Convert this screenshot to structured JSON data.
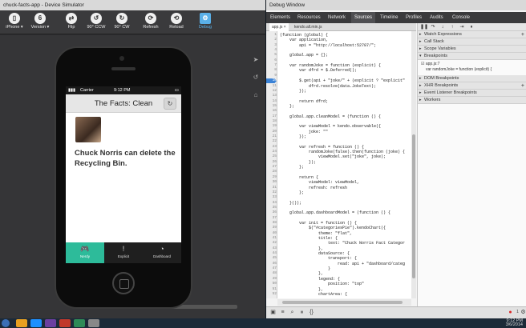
{
  "simulator": {
    "title": "chuck-facts-app - Device Simulator",
    "toolbar": [
      {
        "label": "iPhone ▾",
        "icon": "phone-icon",
        "glyph": "▯"
      },
      {
        "label": "Version ▾",
        "icon": "version-icon",
        "glyph": "6"
      },
      {
        "label": "Flip",
        "icon": "flip-icon",
        "glyph": "⇄"
      },
      {
        "label": "90° CCW",
        "icon": "rotate-ccw-icon",
        "glyph": "↺"
      },
      {
        "label": "90° CW",
        "icon": "rotate-cw-icon",
        "glyph": "↻"
      },
      {
        "label": "Refresh",
        "icon": "refresh-icon",
        "glyph": "⟳"
      },
      {
        "label": "Reload",
        "icon": "reload-icon",
        "glyph": "⟲"
      },
      {
        "label": "Debug",
        "icon": "debug-icon",
        "glyph": "⚙"
      }
    ],
    "side_icons": [
      "➤",
      "↺",
      "⌂"
    ],
    "phone": {
      "status_carrier": "Carrier",
      "status_time": "9:12 PM",
      "nav_title": "The Facts: Clean",
      "refresh_glyph": "↻",
      "joke": "Chuck Norris can delete the Recycling Bin.",
      "tabs": [
        {
          "label": "Nerdy",
          "glyph": "🎮"
        },
        {
          "label": "Explicit",
          "glyph": "!"
        },
        {
          "label": "Dashboard",
          "glyph": "◔"
        }
      ]
    }
  },
  "debugger": {
    "title": "Debug Window",
    "tabs": [
      "Elements",
      "Resources",
      "Network",
      "Sources",
      "Timeline",
      "Profiles",
      "Audits",
      "Console"
    ],
    "active_tab": "Sources",
    "files": [
      "app.js ×",
      "kendo.all.min.js"
    ],
    "gutter_numbers": [
      "1",
      "2",
      "3",
      "4",
      "5",
      "6",
      "7",
      "8",
      "9",
      "10",
      "11",
      "12",
      "13",
      "14",
      "15",
      "16",
      "17",
      "18",
      "19",
      "20",
      "21",
      "22",
      "23",
      "24",
      "25",
      "26",
      "27",
      "28",
      "29",
      "30",
      "31",
      "32",
      "33",
      "34",
      "35",
      "36",
      "37",
      "38",
      "39",
      "40",
      "41",
      "42",
      "43",
      "44",
      "45",
      "46",
      "47",
      "48",
      "49",
      "50",
      "51",
      "52"
    ],
    "breakpoint_line": "10",
    "code_lines": [
      "(function (global) {",
      "    var application,",
      "        api = \"http://localhost:52787/\";",
      "",
      "    global.app = {};",
      "",
      "    var randomJoke = function (explicit) {",
      "        var dfrd = $.Deferred();",
      "",
      "        $.get(api + \"joke/\" + (explicit ? \"explicit\"",
      "            dfrd.resolve(data.JokeText);",
      "        });",
      "",
      "        return dfrd;",
      "    };",
      "",
      "    global.app.cleanModel = (function () {",
      "",
      "        var viewModel = kendo.observable({",
      "            joke: \"\"",
      "        });",
      "",
      "        var refresh = function () {",
      "            randomJoke(false).then(function (joke) {",
      "                viewModel.set(\"joke\", joke);",
      "            });",
      "        };",
      "",
      "        return {",
      "            viewModel: viewModel,",
      "            refresh: refresh",
      "        };",
      "",
      "    }());",
      "",
      "    global.app.dashboardModel = (function () {",
      "",
      "        var init = function () {",
      "            $(\"#categoriesPie\").kendoChart({",
      "                theme: \"flat\",",
      "                title: {",
      "                    text: \"Chuck Norris Fact Categor",
      "                },",
      "                dataSource: {",
      "                    transport: {",
      "                        read: api + \"dashboard/categ",
      "                    }",
      "                },",
      "                legend: {",
      "                    position: \"top\"",
      "                },",
      "                chartArea: {"
    ],
    "panel_sections": [
      {
        "label": "Watch Expressions",
        "open": false,
        "plus": true
      },
      {
        "label": "Call Stack",
        "open": false,
        "plus": false
      },
      {
        "label": "Scope Variables",
        "open": false,
        "plus": false
      },
      {
        "label": "Breakpoints",
        "open": true,
        "plus": false
      },
      {
        "label": "DOM Breakpoints",
        "open": false,
        "plus": false
      },
      {
        "label": "XHR Breakpoints",
        "open": false,
        "plus": true
      },
      {
        "label": "Event Listener Breakpoints",
        "open": false,
        "plus": false
      },
      {
        "label": "Workers",
        "open": false,
        "plus": false
      }
    ],
    "breakpoint_file": "☑ app.js:7",
    "breakpoint_code": "var randomJoke = function (explicit) {",
    "error_count": "1"
  },
  "taskbar": {
    "time": "9:12 PM",
    "date": "3/6/2014"
  },
  "colors": {
    "accent_tab": "#2dbb9a",
    "breakpoint": "#3a82d6"
  }
}
